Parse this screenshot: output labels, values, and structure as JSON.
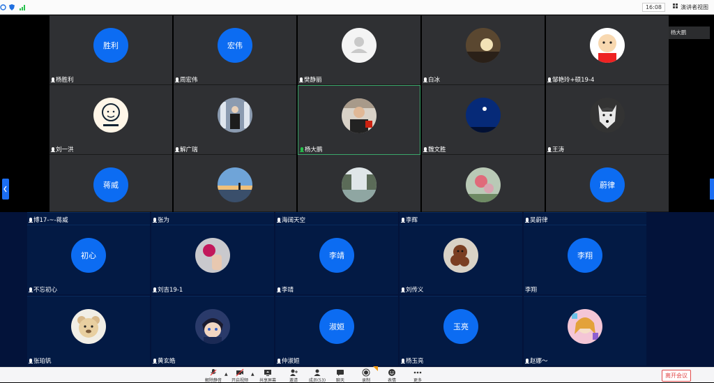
{
  "topbar": {
    "time": "16:08",
    "speaker_view_label": "演讲者视图",
    "icons": [
      "settings-icon",
      "shield-icon",
      "signal-icon"
    ]
  },
  "speaking": "正在讲话: 杨大鹏",
  "upper_rows": [
    [
      {
        "name": "杨胜利",
        "avatar_text": "胜利",
        "type": "text"
      },
      {
        "name": "周宏伟",
        "avatar_text": "宏伟",
        "type": "text"
      },
      {
        "name": "樊静丽",
        "type": "default"
      },
      {
        "name": "白冰",
        "type": "photo",
        "icon": "dark-portrait"
      },
      {
        "name": "邹艳玲+硕19-4",
        "type": "photo",
        "icon": "cartoon-baby"
      }
    ],
    [
      {
        "name": "刘一洪",
        "type": "photo",
        "icon": "cartoon-face"
      },
      {
        "name": "解广瑞",
        "type": "photo",
        "icon": "standing-person"
      },
      {
        "name": "杨大鹏",
        "type": "photo",
        "icon": "man-portrait",
        "active": true
      },
      {
        "name": "魏文胜",
        "type": "photo",
        "icon": "moon-night"
      },
      {
        "name": "王涛",
        "type": "photo",
        "icon": "husky-dog"
      }
    ],
    [
      {
        "name": "博17-~-蒋威",
        "avatar_text": "蒋威",
        "type": "text"
      },
      {
        "name": "张为",
        "type": "photo",
        "icon": "sunset-lake"
      },
      {
        "name": "海阔天空",
        "type": "photo",
        "icon": "canal-town"
      },
      {
        "name": "李辉",
        "type": "photo",
        "icon": "flower-pink"
      },
      {
        "name": "吴蔚律",
        "avatar_text": "蔚律",
        "type": "text"
      }
    ]
  ],
  "lower_rows": [
    [
      {
        "name": "不忘初心",
        "avatar_text": "初心",
        "type": "text"
      },
      {
        "name": "刘吉19-1",
        "type": "photo",
        "icon": "pink-flower-hand"
      },
      {
        "name": "李靖",
        "avatar_text": "李靖",
        "type": "text"
      },
      {
        "name": "刘传义",
        "type": "photo",
        "icon": "poodle-dog"
      },
      {
        "name": "李翔",
        "avatar_text": "李翔",
        "type": "text",
        "no_mic": true
      }
    ],
    [
      {
        "name": "张珀钒",
        "type": "photo",
        "icon": "teddy-bear"
      },
      {
        "name": "黄玄皓",
        "type": "photo",
        "icon": "anime-boy"
      },
      {
        "name": "仲淑姮",
        "avatar_text": "淑姮",
        "type": "text"
      },
      {
        "name": "杨玉亮",
        "avatar_text": "玉亮",
        "type": "text"
      },
      {
        "name": "赵娜～",
        "type": "photo",
        "icon": "colorful-girl"
      }
    ]
  ],
  "toolbar": {
    "buttons": [
      {
        "label": "解除静音",
        "icon": "mic-muted-icon"
      },
      {
        "label": "开启视频",
        "icon": "camera-off-icon"
      },
      {
        "label": "共享屏幕",
        "icon": "share-screen-icon"
      },
      {
        "label": "邀请",
        "icon": "invite-icon"
      },
      {
        "label": "成员(53)",
        "icon": "members-icon"
      },
      {
        "label": "聊天",
        "icon": "chat-icon"
      },
      {
        "label": "录制",
        "icon": "record-icon"
      },
      {
        "label": "表情",
        "icon": "emoji-icon"
      },
      {
        "label": "更多",
        "icon": "more-icon"
      }
    ],
    "leave_label": "离开会议"
  }
}
